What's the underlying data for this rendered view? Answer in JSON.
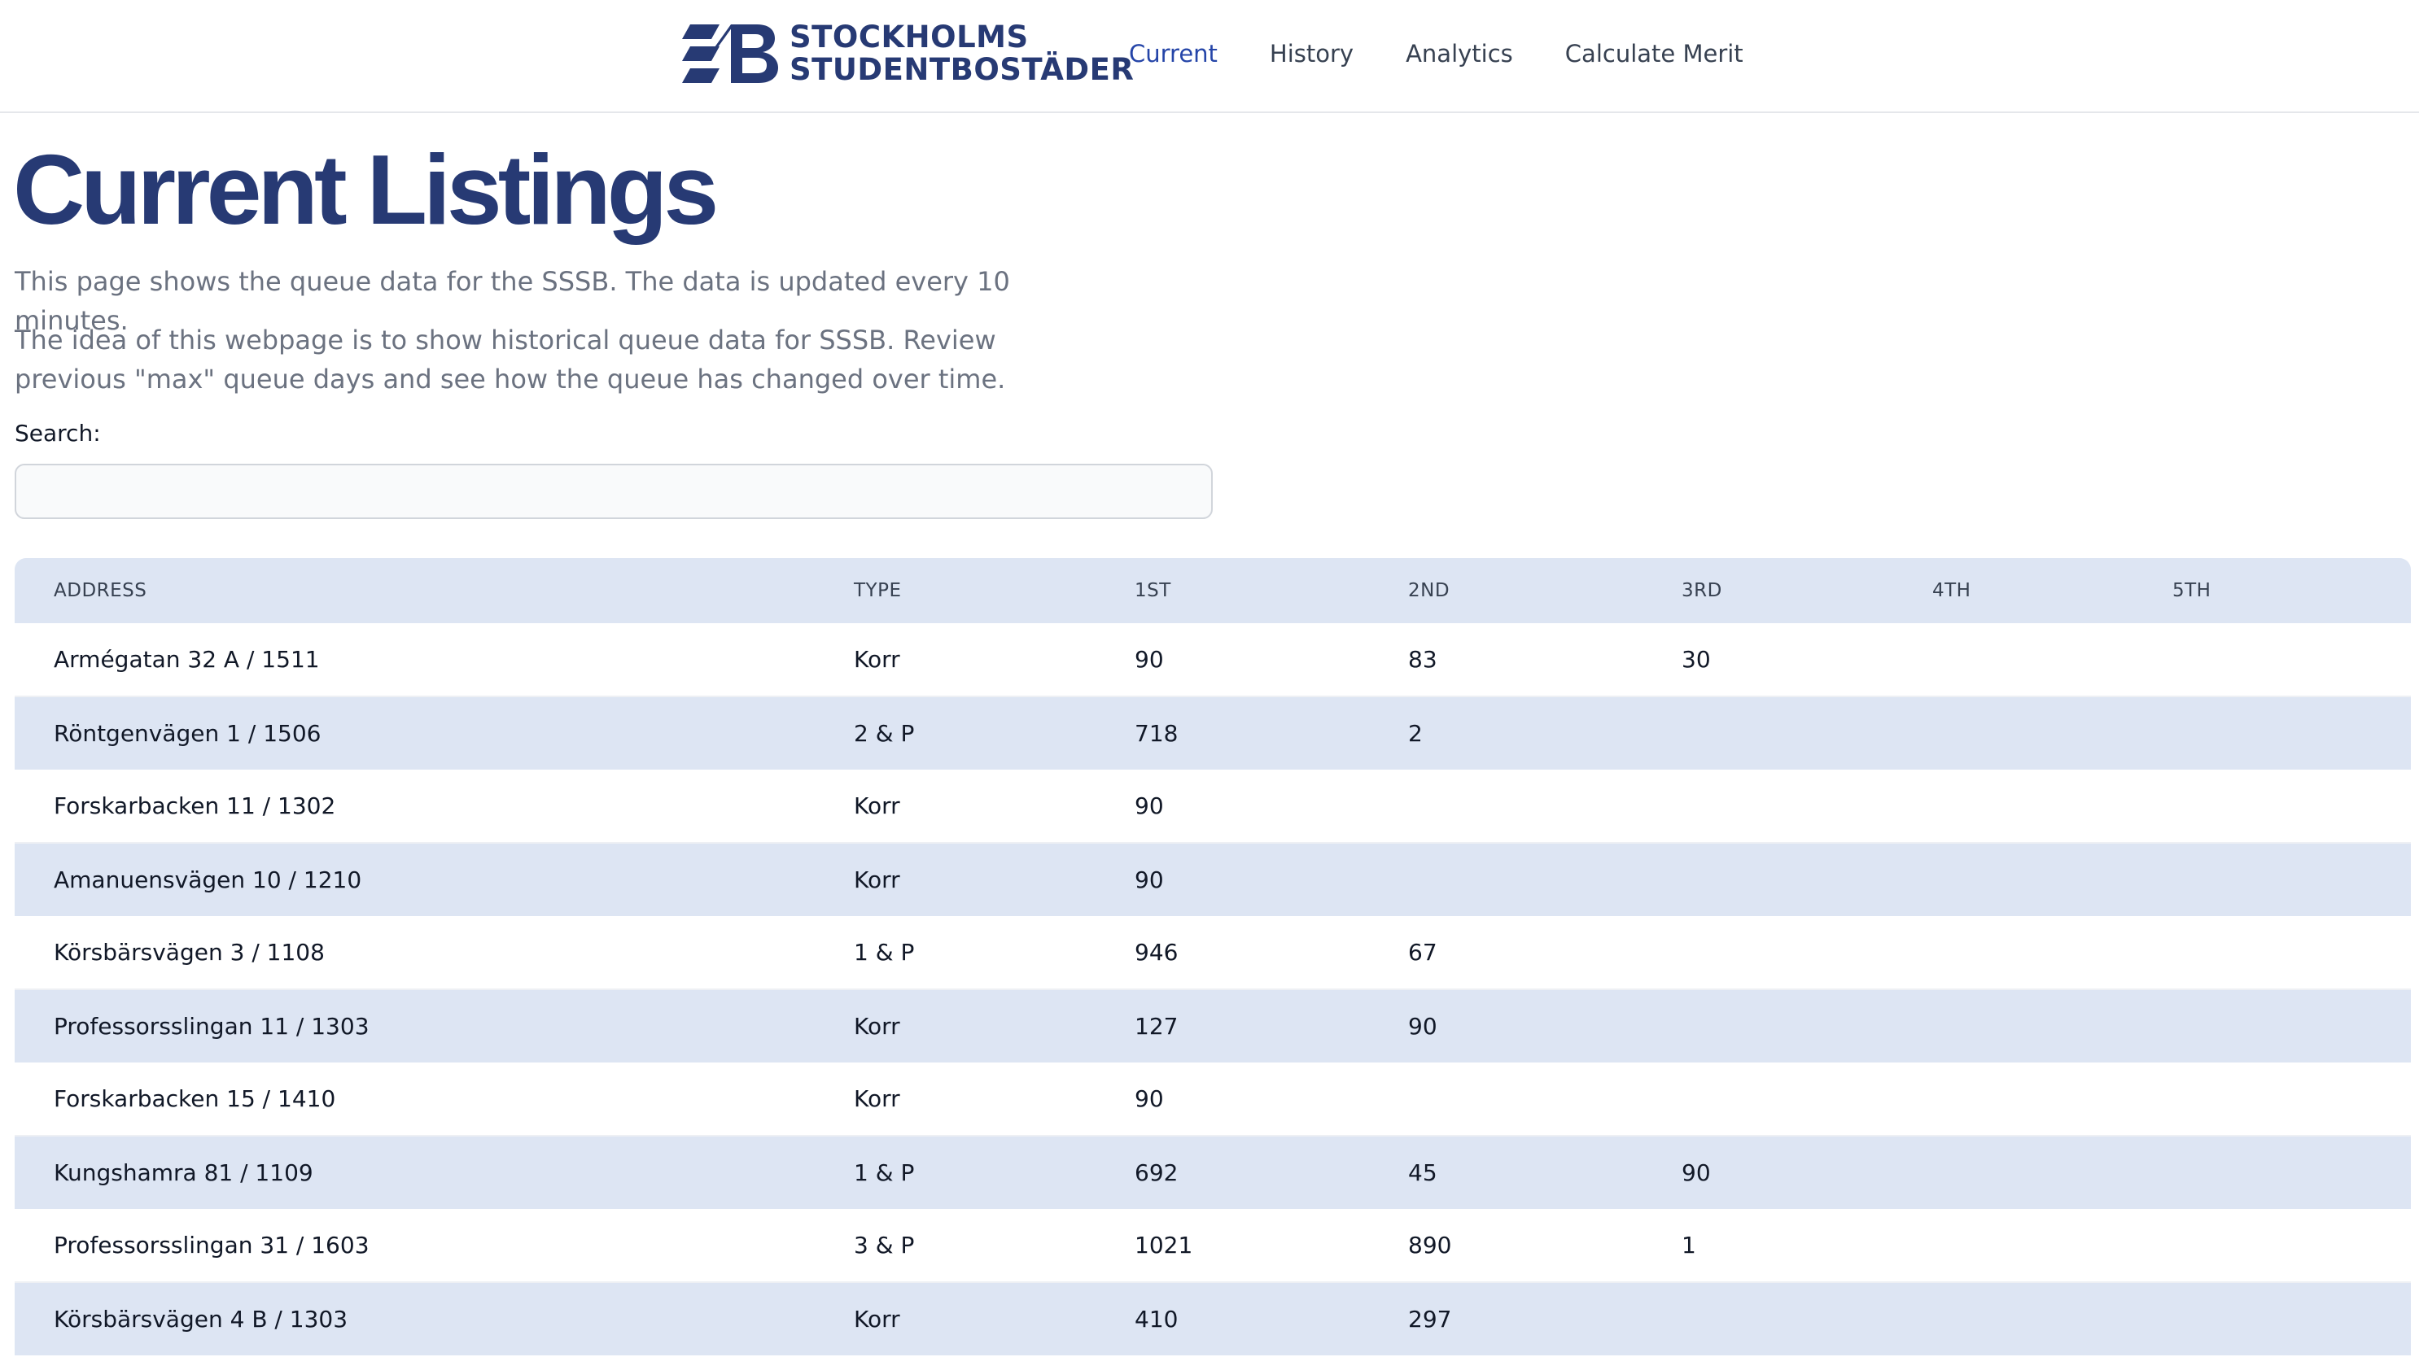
{
  "brand": {
    "line1": "STOCKHOLMS",
    "line2": "STUDENTBOSTÄDER",
    "color": "#273a74"
  },
  "nav": {
    "items": [
      {
        "label": "Current",
        "active": true
      },
      {
        "label": "History",
        "active": false
      },
      {
        "label": "Analytics",
        "active": false
      },
      {
        "label": "Calculate Merit",
        "active": false
      }
    ],
    "active_color": "#2545a8"
  },
  "page": {
    "title": "Current Listings",
    "description1": "This page shows the queue data for the SSSB. The data is updated every 10 minutes.",
    "description2": "The idea of this webpage is to show historical queue data for SSSB. Review previous \"max\" queue days and see how the queue has changed over time."
  },
  "search": {
    "label": "Search:",
    "value": "",
    "placeholder": ""
  },
  "table": {
    "headers": [
      "ADDRESS",
      "TYPE",
      "1ST",
      "2ND",
      "3RD",
      "4TH",
      "5TH"
    ],
    "rows": [
      [
        "Armégatan 32 A / 1511",
        "Korr",
        "90",
        "83",
        "30",
        "",
        ""
      ],
      [
        "Röntgenvägen 1 / 1506",
        "2 & P",
        "718",
        "2",
        "",
        "",
        ""
      ],
      [
        "Forskarbacken 11 / 1302",
        "Korr",
        "90",
        "",
        "",
        "",
        ""
      ],
      [
        "Amanuensvägen 10 / 1210",
        "Korr",
        "90",
        "",
        "",
        "",
        ""
      ],
      [
        "Körsbärsvägen 3 / 1108",
        "1 & P",
        "946",
        "67",
        "",
        "",
        ""
      ],
      [
        "Professorsslingan 11 / 1303",
        "Korr",
        "127",
        "90",
        "",
        "",
        ""
      ],
      [
        "Forskarbacken 15 / 1410",
        "Korr",
        "90",
        "",
        "",
        "",
        ""
      ],
      [
        "Kungshamra 81 / 1109",
        "1 & P",
        "692",
        "45",
        "90",
        "",
        ""
      ],
      [
        "Professorsslingan 31 / 1603",
        "3 & P",
        "1021",
        "890",
        "1",
        "",
        ""
      ],
      [
        "Körsbärsvägen 4 B / 1303",
        "Korr",
        "410",
        "297",
        "",
        "",
        ""
      ]
    ],
    "header_bg": "#dde5f3",
    "stripe_bg": "#dde5f3"
  }
}
